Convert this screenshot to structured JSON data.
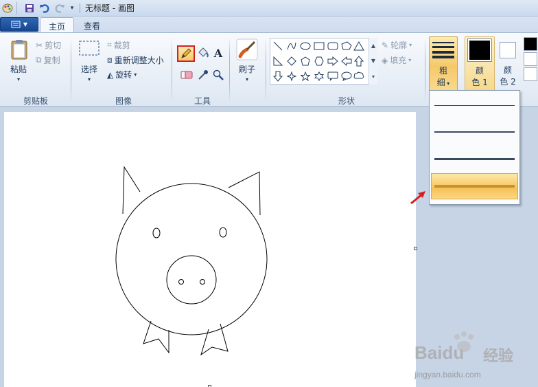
{
  "window": {
    "title": "无标题 - 画图"
  },
  "tabs": [
    {
      "label": "主页",
      "active": true
    },
    {
      "label": "查看",
      "active": false
    }
  ],
  "groups": {
    "clipboard": {
      "label": "剪贴板",
      "paste": "粘贴",
      "cut": "剪切",
      "copy": "复制"
    },
    "image": {
      "label": "图像",
      "select": "选择",
      "crop": "裁剪",
      "resize": "重新调整大小",
      "rotate": "旋转"
    },
    "tools": {
      "label": "工具",
      "selected_tool": "pencil-icon"
    },
    "brushes": {
      "label": "刷子"
    },
    "shapes": {
      "label": "形状",
      "outline": "轮廓",
      "fill": "填充"
    },
    "size": {
      "label_1": "粗",
      "label_2": "细"
    },
    "color1": {
      "label_1": "颜",
      "label_2": "色 1",
      "value": "#000000"
    },
    "color2": {
      "label_1": "颜",
      "label_2": "色 2",
      "value": "#ffffff"
    }
  },
  "size_dropdown": {
    "options": [
      {
        "name": "1px",
        "selected": false
      },
      {
        "name": "3px",
        "selected": false
      },
      {
        "name": "5px",
        "selected": false
      },
      {
        "name": "8px",
        "selected": true
      }
    ]
  },
  "colors": {
    "accent_selected": "#f7c25a",
    "highlight_border": "#d42020",
    "arrow": "#d42020"
  },
  "watermark": {
    "brand": "Bai",
    "brand2": "du",
    "site_cn": "经验",
    "url": "jingyan.baidu.com"
  }
}
